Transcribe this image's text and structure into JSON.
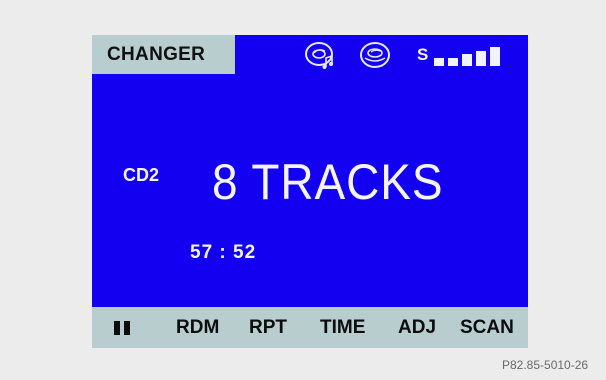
{
  "mode": {
    "label": "CHANGER"
  },
  "status_icons": [
    "cd-note-icon",
    "cd-disc-icon"
  ],
  "signal": {
    "label": "S",
    "level_bars": 5
  },
  "main": {
    "disc": "CD2",
    "tracks": "8 TRACKS",
    "time": "57 : 52"
  },
  "softkeys": {
    "pause_icon": "pause-icon",
    "rdm": "RDM",
    "rpt": "RPT",
    "time": "TIME",
    "adj": "ADJ",
    "scan": "SCAN"
  },
  "reference": "P82.85-5010-26",
  "colors": {
    "screen": "#1400f0",
    "bar": "#b7cdce",
    "text_light": "#f4f4ff",
    "text_dark": "#0d0d0d",
    "background": "#ececec"
  }
}
